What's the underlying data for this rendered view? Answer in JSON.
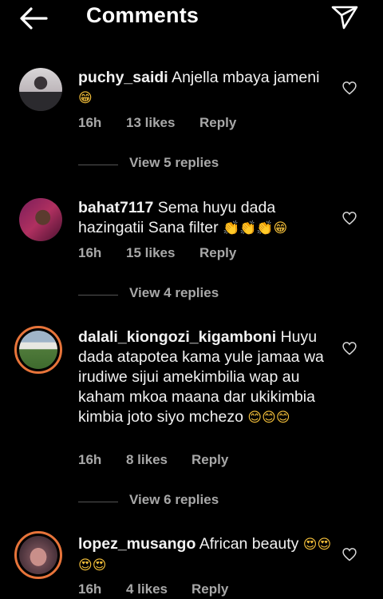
{
  "header": {
    "title": "Comments",
    "back_icon": "arrow-left-icon",
    "share_icon": "paper-plane-icon"
  },
  "comments": [
    {
      "username": "puchy_saidi",
      "text": "Anjella mbaya jameni",
      "emoji": "😁",
      "time": "16h",
      "likes": "13 likes",
      "reply": "Reply",
      "view_replies": "View 5 replies"
    },
    {
      "username": "bahat7117",
      "text": "Sema huyu dada hazingatii Sana filter",
      "emoji": "👏👏👏😁",
      "time": "16h",
      "likes": "15 likes",
      "reply": "Reply",
      "view_replies": "View 4 replies"
    },
    {
      "username": "dalali_kiongozi_kigamboni",
      "text": "Huyu dada atapotea kama yule jamaa wa irudiwe sijui amekimbilia wap au kaham mkoa maana dar ukikimbia kimbia joto siyo mchezo",
      "emoji": "😊😊😊",
      "time": "16h",
      "likes": "8 likes",
      "reply": "Reply",
      "view_replies": "View 6 replies"
    },
    {
      "username": "lopez_musango",
      "text": "African beauty",
      "emoji": "😍😍😍😍",
      "time": "16h",
      "likes": "4 likes",
      "reply": "Reply"
    }
  ],
  "colors": {
    "background": "#000000",
    "text": "#ffffff",
    "secondary_text": "#a8a8a8",
    "story_ring": "#e7743a"
  }
}
